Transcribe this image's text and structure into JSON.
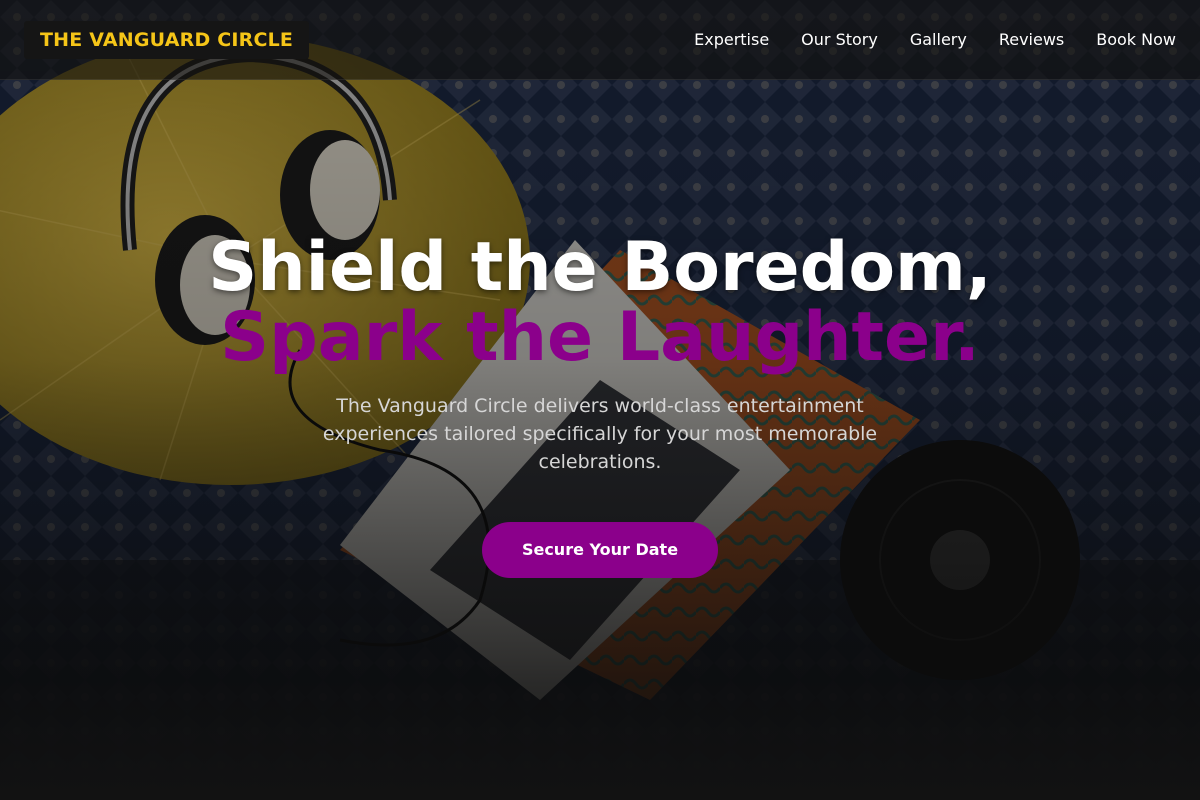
{
  "brand": {
    "name": "THE VANGUARD CIRCLE"
  },
  "nav": {
    "items": [
      {
        "label": "Expertise"
      },
      {
        "label": "Our Story"
      },
      {
        "label": "Gallery"
      },
      {
        "label": "Reviews"
      },
      {
        "label": "Book Now"
      }
    ]
  },
  "hero": {
    "headline_line1": "Shield the Boredom,",
    "headline_line2": "Spark the Laughter.",
    "subtitle": "The Vanguard Circle delivers world-class entertainment experiences tailored specifically for your most memorable celebrations.",
    "cta_label": "Secure Your Date"
  },
  "colors": {
    "accent": "#8b008b",
    "logo_text": "#f5c518",
    "logo_bg": "#151515",
    "nav_text": "#ffffff"
  }
}
